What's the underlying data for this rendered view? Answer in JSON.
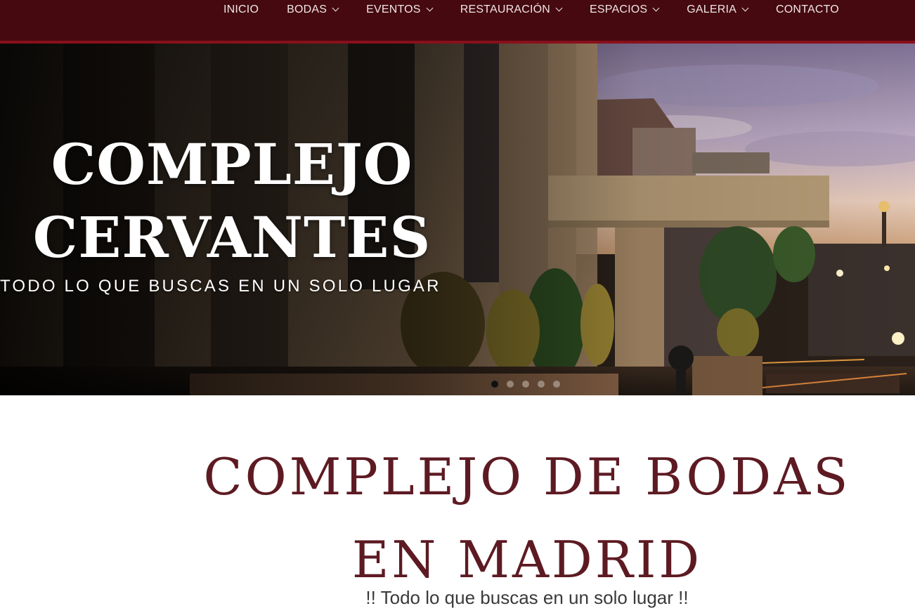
{
  "nav": {
    "items": [
      {
        "label": "INICIO",
        "has_dropdown": false
      },
      {
        "label": "BODAS",
        "has_dropdown": true
      },
      {
        "label": "EVENTOS",
        "has_dropdown": true
      },
      {
        "label": "RESTAURACIÓN",
        "has_dropdown": true
      },
      {
        "label": "ESPACIOS",
        "has_dropdown": true
      },
      {
        "label": "GALERIA",
        "has_dropdown": true
      },
      {
        "label": "CONTACTO",
        "has_dropdown": false
      }
    ]
  },
  "hero": {
    "title_line1": "COMPLEJO",
    "title_line2": "CERVANTES",
    "subtitle": "TODO LO QUE BUSCAS EN UN SOLO LUGAR",
    "slides_total": 5,
    "active_slide": 1
  },
  "content": {
    "title_line1": "COMPLEJO DE BODAS",
    "title_line2": "EN MADRID",
    "subtitle": "!! Todo lo que buscas en un solo lugar !!"
  },
  "colors": {
    "nav_bg": "#45090f",
    "nav_border": "#8a0f1b",
    "heading": "#5d1a22"
  }
}
